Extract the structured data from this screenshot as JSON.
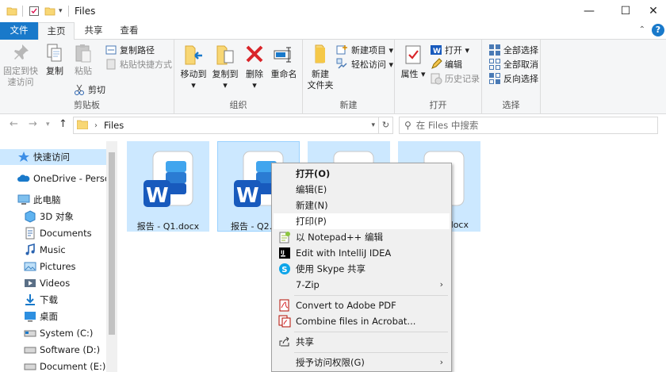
{
  "window": {
    "title": "Files",
    "controls": {
      "minimize": "—",
      "maximize": "☐",
      "close": "✕"
    }
  },
  "tabs": {
    "file": "文件",
    "home": "主页",
    "share": "共享",
    "view": "查看"
  },
  "ribbon": {
    "clipboard": {
      "label": "剪贴板",
      "pin": "固定到快\n速访问",
      "copy": "复制",
      "paste": "粘贴",
      "copy_path": "复制路径",
      "paste_shortcut": "粘贴快捷方式",
      "cut": "剪切"
    },
    "organize": {
      "label": "组织",
      "move_to": "移动到",
      "copy_to": "复制到",
      "delete": "删除",
      "rename": "重命名"
    },
    "new": {
      "label": "新建",
      "new_folder": "新建\n文件夹",
      "new_item": "新建项目",
      "easy_access": "轻松访问"
    },
    "open": {
      "label": "打开",
      "properties": "属性",
      "open": "打开",
      "edit": "编辑",
      "history": "历史记录"
    },
    "select": {
      "label": "选择",
      "select_all": "全部选择",
      "select_none": "全部取消",
      "invert": "反向选择"
    }
  },
  "address": {
    "path": "Files",
    "search_placeholder": "在 Files 中搜索"
  },
  "nav": {
    "items": [
      {
        "label": "快速访问",
        "icon": "star-icon"
      },
      {
        "label": "OneDrive - Person",
        "icon": "cloud-icon"
      },
      {
        "label": "此电脑",
        "icon": "computer-icon"
      },
      {
        "label": "3D 对象",
        "icon": "3d-objects-icon"
      },
      {
        "label": "Documents",
        "icon": "documents-icon"
      },
      {
        "label": "Music",
        "icon": "music-icon"
      },
      {
        "label": "Pictures",
        "icon": "pictures-icon"
      },
      {
        "label": "Videos",
        "icon": "videos-icon"
      },
      {
        "label": "下载",
        "icon": "download-icon"
      },
      {
        "label": "桌面",
        "icon": "desktop-icon"
      },
      {
        "label": "System (C:)",
        "icon": "drive-icon"
      },
      {
        "label": "Software (D:)",
        "icon": "drive-icon"
      },
      {
        "label": "Document (E:)",
        "icon": "drive-icon"
      }
    ]
  },
  "files": [
    {
      "name": "报告 - Q1.docx"
    },
    {
      "name": "报告 - Q2.docx"
    },
    {
      "name": ""
    },
    {
      "name": ".docx"
    }
  ],
  "context_menu": {
    "open": "打开(O)",
    "edit": "编辑(E)",
    "new": "新建(N)",
    "print": "打印(P)",
    "notepadpp": "以 Notepad++ 编辑",
    "intellij": "Edit with IntelliJ IDEA",
    "skype": "使用 Skype 共享",
    "sevenzip": "7-Zip",
    "to_pdf": "Convert to Adobe PDF",
    "combine": "Combine files in Acrobat...",
    "share": "共享",
    "grant_access": "授予访问权限(G)"
  },
  "colors": {
    "accent": "#1979ca",
    "selection": "#cce8ff",
    "word_blue": "#185abd"
  }
}
